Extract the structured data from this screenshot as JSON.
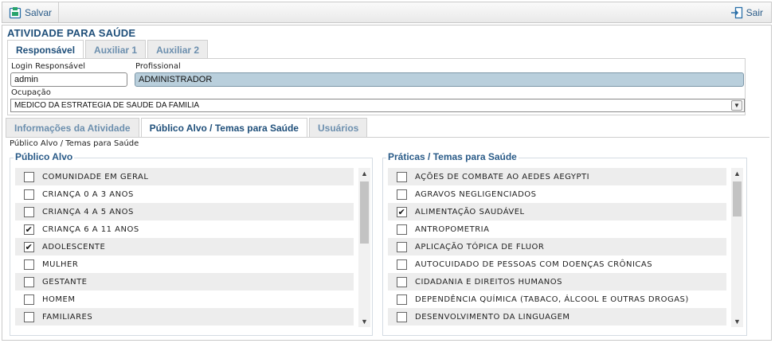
{
  "toolbar": {
    "save_label": "Salvar",
    "exit_label": "Sair"
  },
  "form": {
    "title": "ATIVIDADE PARA SAÚDE",
    "tabs": [
      "Responsável",
      "Auxiliar 1",
      "Auxiliar 2"
    ],
    "active_tab": 0,
    "login_label": "Login Responsável",
    "login_value": "admin",
    "profissional_label": "Profissional",
    "profissional_value": "ADMINISTRADOR",
    "ocupacao_label": "Ocupação",
    "ocupacao_value": "MEDICO DA ESTRATEGIA DE SAUDE DA FAMILIA"
  },
  "subtabs": {
    "items": [
      "Informações da Atividade",
      "Público Alvo / Temas para Saúde",
      "Usuários"
    ],
    "active": 1
  },
  "section": {
    "caption": "Público Alvo / Temas para Saúde"
  },
  "publico_alvo": {
    "legend": "Público Alvo",
    "items": [
      {
        "label": "COMUNIDADE EM GERAL",
        "checked": false
      },
      {
        "label": "CRIANÇA 0 A 3 ANOS",
        "checked": false
      },
      {
        "label": "CRIANÇA 4 A 5 ANOS",
        "checked": false
      },
      {
        "label": "CRIANÇA 6 A 11 ANOS",
        "checked": true
      },
      {
        "label": "ADOLESCENTE",
        "checked": true
      },
      {
        "label": "MULHER",
        "checked": false
      },
      {
        "label": "GESTANTE",
        "checked": false
      },
      {
        "label": "HOMEM",
        "checked": false
      },
      {
        "label": "FAMILIARES",
        "checked": false
      }
    ]
  },
  "praticas": {
    "legend": "Práticas / Temas para Saúde",
    "items": [
      {
        "label": "AÇÕES DE COMBATE AO AEDES AEGYPTI",
        "checked": false
      },
      {
        "label": "AGRAVOS NEGLIGENCIADOS",
        "checked": false
      },
      {
        "label": "ALIMENTAÇÃO SAUDÁVEL",
        "checked": true
      },
      {
        "label": "ANTROPOMETRIA",
        "checked": false
      },
      {
        "label": "APLICAÇÃO TÓPICA DE FLUOR",
        "checked": false
      },
      {
        "label": "AUTOCUIDADO DE PESSOAS COM DOENÇAS CRÔNICAS",
        "checked": false
      },
      {
        "label": "CIDADANIA E DIREITOS HUMANOS",
        "checked": false
      },
      {
        "label": "DEPENDÊNCIA QUÍMICA (TABACO, ÁLCOOL E OUTRAS DROGAS)",
        "checked": false
      },
      {
        "label": "DESENVOLVIMENTO DA LINGUAGEM",
        "checked": false
      }
    ]
  },
  "icons": {
    "save": "save-icon",
    "exit": "exit-icon",
    "check": "✔",
    "scroll_up": "^",
    "scroll_down": "v",
    "dropdown": "v"
  },
  "colors": {
    "accent": "#1f4f7a",
    "tab_inactive": "#6c8fae",
    "readonly_field": "#b9cfdc"
  }
}
